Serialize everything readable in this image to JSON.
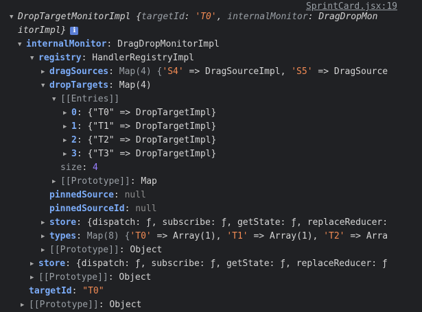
{
  "source_link": "SprintCard.jsx:19",
  "header": {
    "line1_name": "DropTargetMonitorImpl",
    "line1_open": "{",
    "line1_k1": "targetId",
    "line1_v1": "'T0'",
    "line1_sep": ", ",
    "line1_k2": "internalMonitor",
    "line1_v2": "DragDropMon",
    "line2_cont": "itorImpl}",
    "info_icon": "i"
  },
  "lines": {
    "internal_monitor_key": "internalMonitor",
    "internal_monitor_val": "DragDropMonitorImpl",
    "registry_key": "registry",
    "registry_val": "HandlerRegistryImpl",
    "drag_sources_key": "dragSources",
    "drag_sources_val_a": "Map(4) {",
    "drag_sources_s4": "'S4'",
    "drag_sources_arrow1": " => DragSourceImpl, ",
    "drag_sources_s5": "'S5'",
    "drag_sources_arrow2": " => DragSource",
    "drop_targets_key": "dropTargets",
    "drop_targets_val": "Map(4)",
    "entries_label": "[[Entries]]",
    "entry0_idx": "0",
    "entry0_val": "{\"T0\" => DropTargetImpl}",
    "entry1_idx": "1",
    "entry1_val": "{\"T1\" => DropTargetImpl}",
    "entry2_idx": "2",
    "entry2_val": "{\"T2\" => DropTargetImpl}",
    "entry3_idx": "3",
    "entry3_val": "{\"T3\" => DropTargetImpl}",
    "size_key": "size",
    "size_val": "4",
    "proto_map_key": "[[Prototype]]",
    "proto_map_val": "Map",
    "pinned_source_key": "pinnedSource",
    "pinned_source_val": "null",
    "pinned_source_id_key": "pinnedSourceId",
    "pinned_source_id_val": "null",
    "store1_key": "store",
    "store1_val": "{dispatch: ƒ, subscribe: ƒ, getState: ƒ, replaceReducer: ",
    "types_key": "types",
    "types_val_a": "Map(8) {",
    "types_t0": "'T0'",
    "types_arr1": " => Array(1), ",
    "types_t1": "'T1'",
    "types_arr2": " => Array(1), ",
    "types_t2": "'T2'",
    "types_arr3": " => Arra",
    "proto_obj1_key": "[[Prototype]]",
    "proto_obj1_val": "Object",
    "store2_key": "store",
    "store2_val": "{dispatch: ƒ, subscribe: ƒ, getState: ƒ, replaceReducer: ƒ",
    "proto_obj2_key": "[[Prototype]]",
    "proto_obj2_val": "Object",
    "target_id_key": "targetId",
    "target_id_val": "\"T0\"",
    "proto_obj3_key": "[[Prototype]]",
    "proto_obj3_val": "Object"
  }
}
